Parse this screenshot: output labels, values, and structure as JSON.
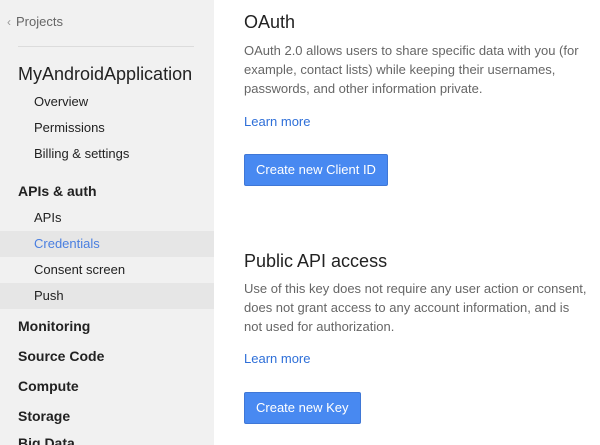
{
  "sidebar": {
    "back_label": "Projects",
    "project_name": "MyAndroidApplication",
    "project_items": [
      {
        "label": "Overview"
      },
      {
        "label": "Permissions"
      },
      {
        "label": "Billing & settings"
      }
    ],
    "apis_heading": "APIs & auth",
    "apis_items": [
      {
        "label": "APIs"
      },
      {
        "label": "Credentials"
      },
      {
        "label": "Consent screen"
      },
      {
        "label": "Push"
      }
    ],
    "sections": [
      {
        "label": "Monitoring"
      },
      {
        "label": "Source Code"
      },
      {
        "label": "Compute"
      },
      {
        "label": "Storage"
      },
      {
        "label": "Big Data"
      }
    ]
  },
  "oauth": {
    "title": "OAuth",
    "description": "OAuth 2.0 allows users to share specific data with you (for example, contact lists) while keeping their usernames, passwords, and other information private.",
    "learn_more": "Learn more",
    "button": "Create new Client ID"
  },
  "public_api": {
    "title": "Public API access",
    "description": "Use of this key does not require any user action or consent, does not grant access to any account information, and is not used for authorization.",
    "learn_more": "Learn more",
    "button": "Create new Key"
  }
}
